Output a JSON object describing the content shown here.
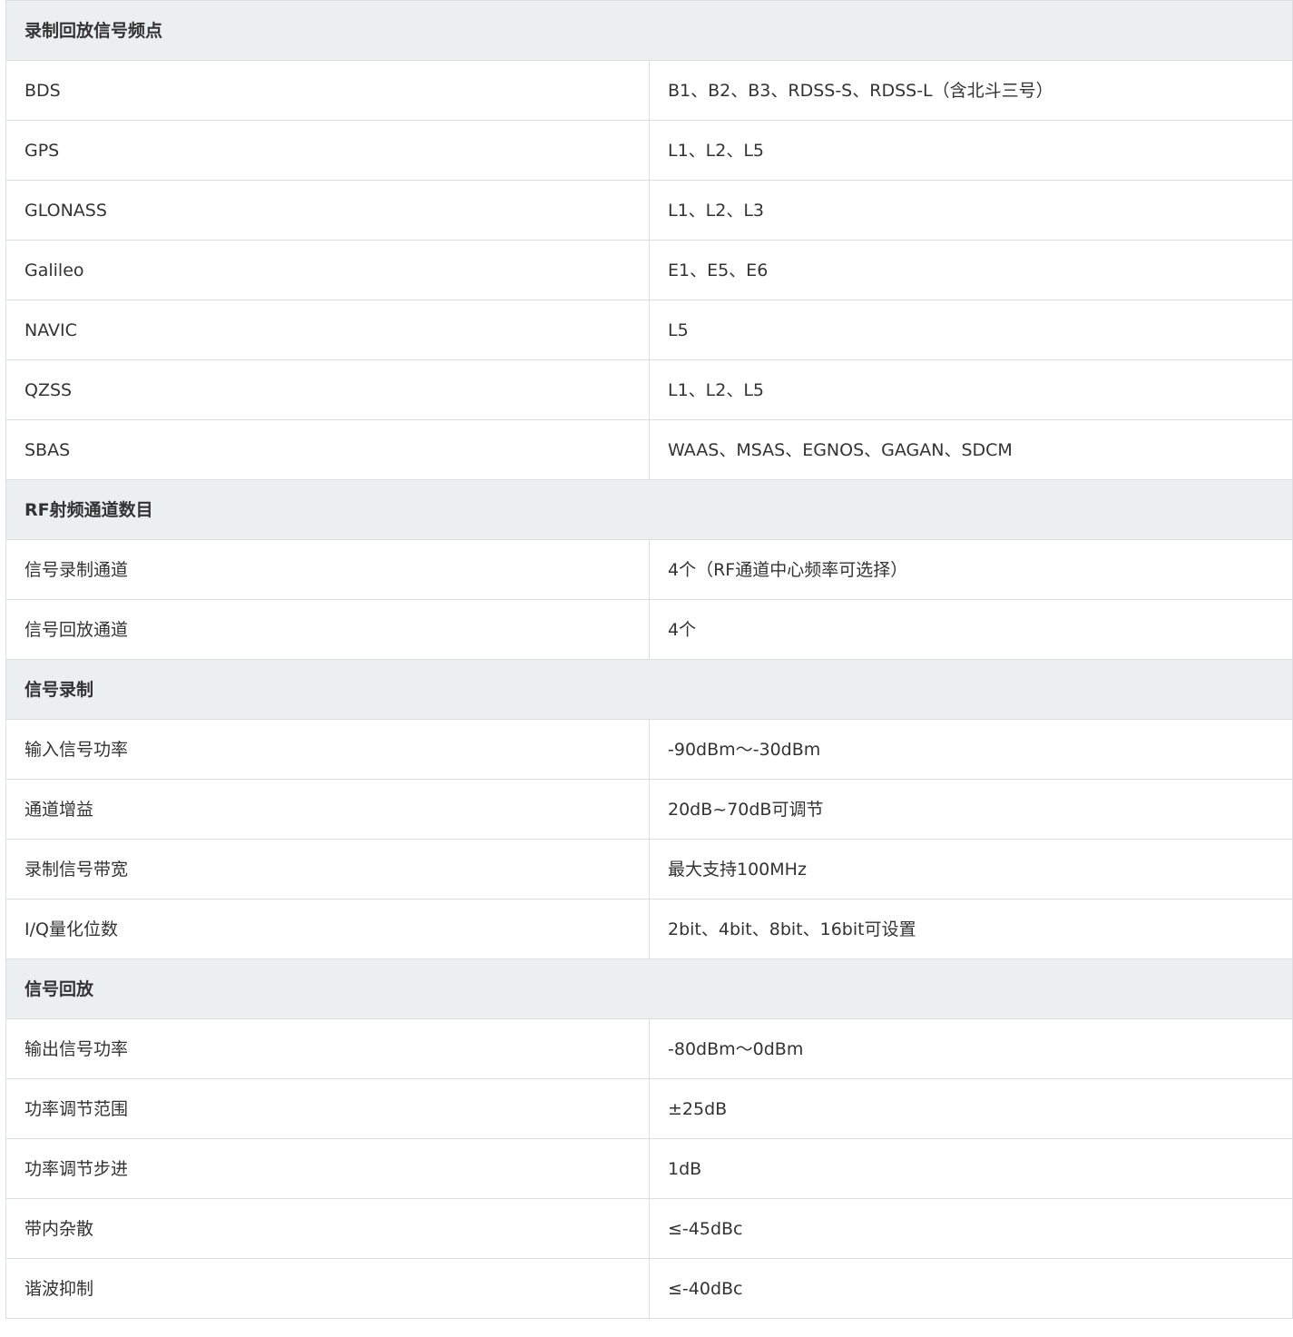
{
  "sections": [
    {
      "title": "录制回放信号频点",
      "rows": [
        {
          "key": "BDS",
          "value": "B1、B2、B3、RDSS-S、RDSS-L（含北斗三号）"
        },
        {
          "key": "GPS",
          "value": "L1、L2、L5"
        },
        {
          "key": "GLONASS",
          "value": "L1、L2、L3"
        },
        {
          "key": "Galileo",
          "value": "E1、E5、E6"
        },
        {
          "key": "NAVIC",
          "value": "L5"
        },
        {
          "key": "QZSS",
          "value": "L1、L2、L5"
        },
        {
          "key": "SBAS",
          "value": "WAAS、MSAS、EGNOS、GAGAN、SDCM"
        }
      ]
    },
    {
      "title": "RF射频通道数目",
      "rows": [
        {
          "key": "信号录制通道",
          "value": "4个（RF通道中心频率可选择）"
        },
        {
          "key": "信号回放通道",
          "value": "4个"
        }
      ]
    },
    {
      "title": "信号录制",
      "rows": [
        {
          "key": "输入信号功率",
          "value": "-90dBm～-30dBm"
        },
        {
          "key": "通道增益",
          "value": "20dB~70dB可调节"
        },
        {
          "key": "录制信号带宽",
          "value": "最大支持100MHz"
        },
        {
          "key": "I/Q量化位数",
          "value": "2bit、4bit、8bit、16bit可设置"
        }
      ]
    },
    {
      "title": "信号回放",
      "rows": [
        {
          "key": "输出信号功率",
          "value": "-80dBm～0dBm"
        },
        {
          "key": "功率调节范围",
          "value": "±25dB"
        },
        {
          "key": "功率调节步进",
          "value": "1dB"
        },
        {
          "key": "带内杂散",
          "value": "≤-45dBc"
        },
        {
          "key": "谐波抑制",
          "value": "≤-40dBc"
        }
      ]
    }
  ]
}
